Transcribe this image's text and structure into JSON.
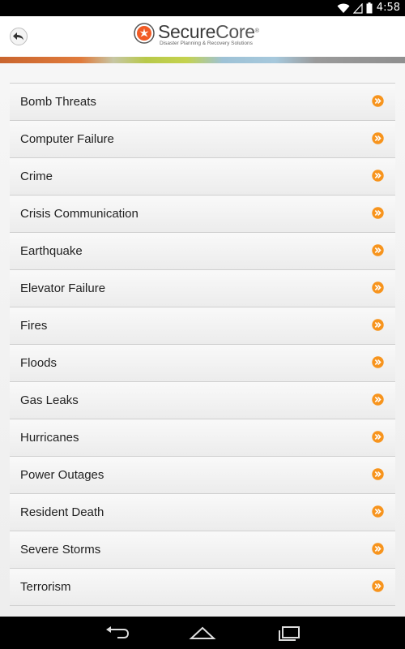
{
  "status_bar": {
    "time": "4:58",
    "icons": [
      "wifi-icon",
      "signal-icon",
      "battery-icon"
    ]
  },
  "header": {
    "back_icon": "back-arrow-icon",
    "logo": {
      "name_part1": "Secure",
      "name_part2": "Core",
      "registered": "®",
      "tagline": "Disaster Planning & Recovery Solutions"
    }
  },
  "colors": {
    "accent": "#f7941d",
    "logo_orange": "#f15a24"
  },
  "topics": [
    {
      "label": "Bomb Threats"
    },
    {
      "label": "Computer Failure"
    },
    {
      "label": "Crime"
    },
    {
      "label": "Crisis Communication"
    },
    {
      "label": "Earthquake"
    },
    {
      "label": "Elevator Failure"
    },
    {
      "label": "Fires"
    },
    {
      "label": "Floods"
    },
    {
      "label": "Gas Leaks"
    },
    {
      "label": "Hurricanes"
    },
    {
      "label": "Power Outages"
    },
    {
      "label": "Resident Death"
    },
    {
      "label": "Severe Storms"
    },
    {
      "label": "Terrorism"
    }
  ],
  "nav_bar": {
    "buttons": [
      "back-nav-icon",
      "home-nav-icon",
      "recents-nav-icon"
    ]
  }
}
